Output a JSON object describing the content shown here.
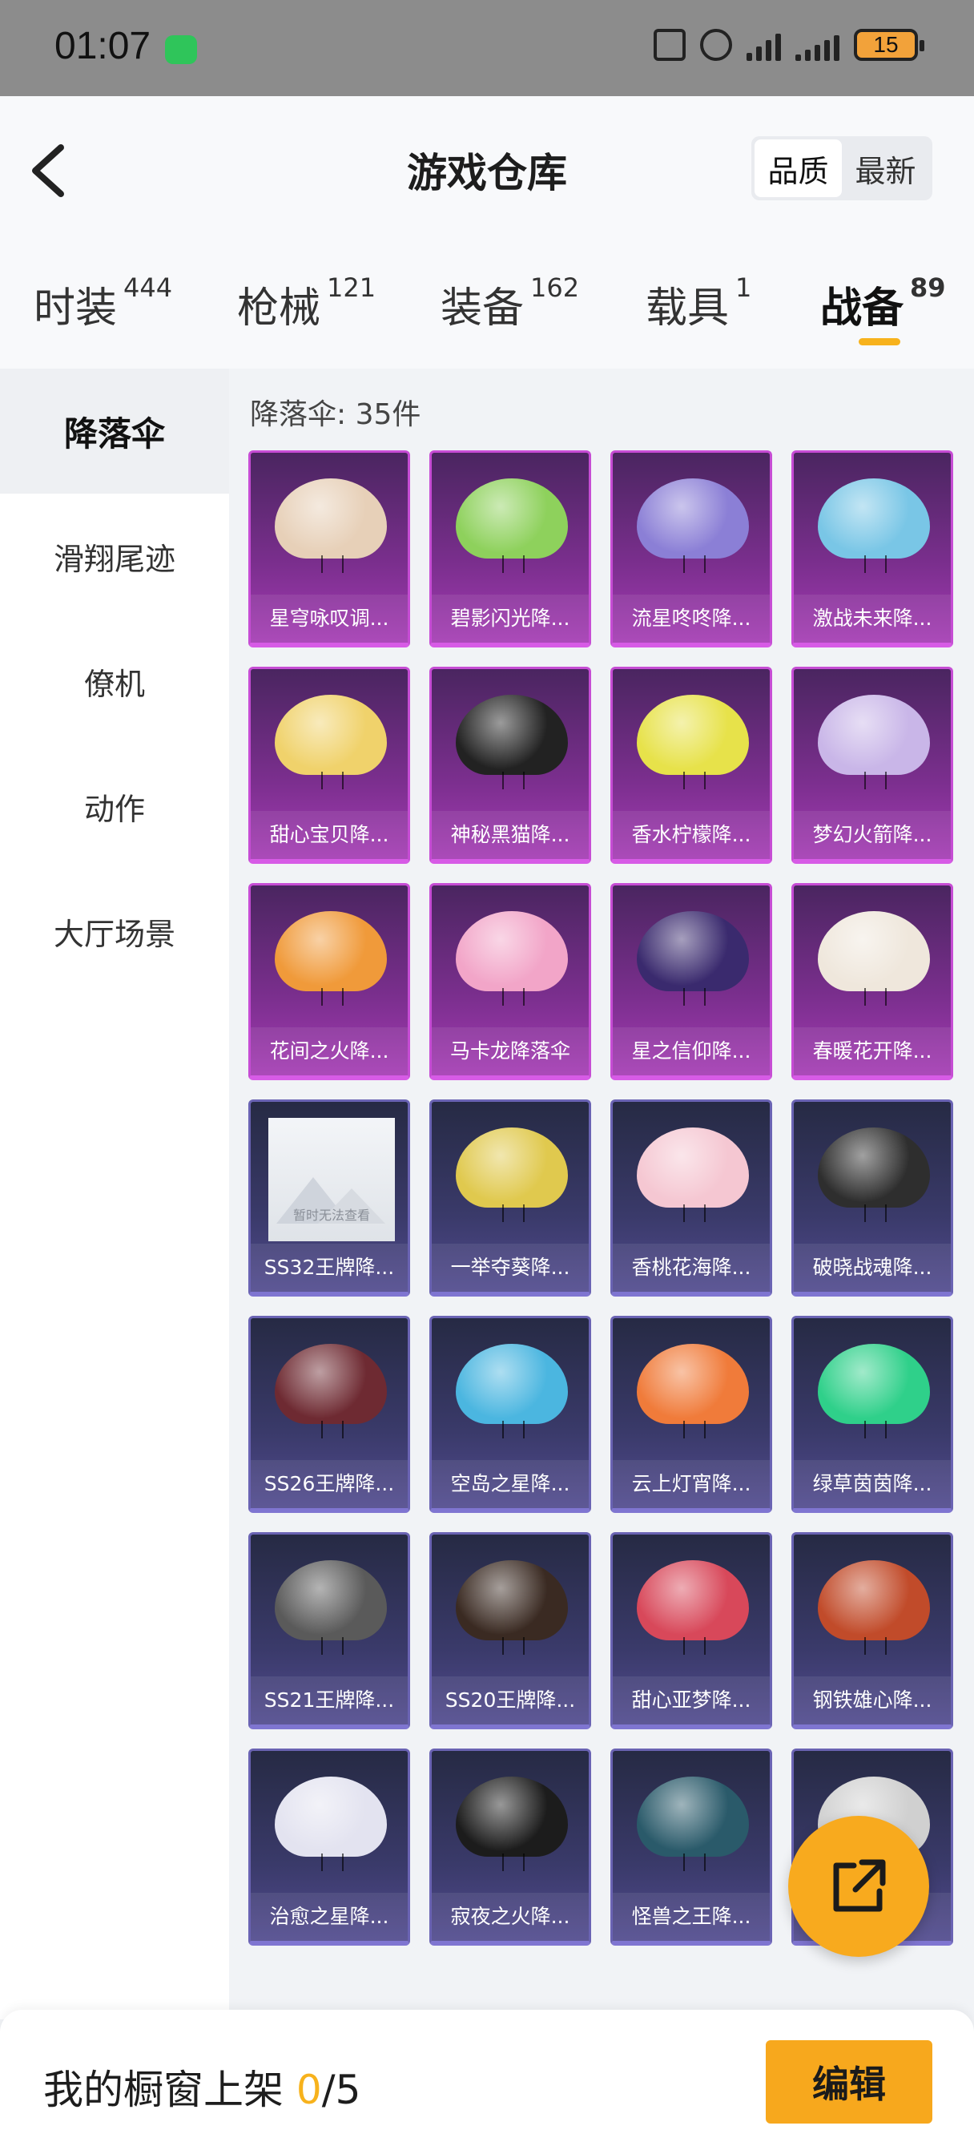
{
  "status_bar": {
    "time": "01:07",
    "battery": "15"
  },
  "header": {
    "title": "游戏仓库",
    "sort_options": [
      "品质",
      "最新"
    ]
  },
  "tabs": [
    {
      "label": "时装",
      "count": "444"
    },
    {
      "label": "枪械",
      "count": "121"
    },
    {
      "label": "装备",
      "count": "162"
    },
    {
      "label": "载具",
      "count": "1"
    },
    {
      "label": "战备",
      "count": "89"
    }
  ],
  "sidebar": [
    "降落伞",
    "滑翔尾迹",
    "僚机",
    "动作",
    "大厅场景"
  ],
  "grid_label": "降落伞: 35件",
  "items": [
    {
      "name": "星穹咏叹调...",
      "tier": "purple",
      "color": "#e7d0b8"
    },
    {
      "name": "碧影闪光降...",
      "tier": "purple",
      "color": "#8ed15c"
    },
    {
      "name": "流星咚咚降...",
      "tier": "purple",
      "color": "#8b7fd6"
    },
    {
      "name": "激战未来降...",
      "tier": "purple",
      "color": "#79c6e6"
    },
    {
      "name": "甜心宝贝降...",
      "tier": "purple",
      "color": "#f0d26b"
    },
    {
      "name": "神秘黑猫降...",
      "tier": "purple",
      "color": "#222222"
    },
    {
      "name": "香水柠檬降...",
      "tier": "purple",
      "color": "#e7e24a"
    },
    {
      "name": "梦幻火箭降...",
      "tier": "purple",
      "color": "#c9b6e8"
    },
    {
      "name": "花间之火降...",
      "tier": "purple",
      "color": "#f09a3a"
    },
    {
      "name": "马卡龙降落伞",
      "tier": "purple",
      "color": "#f2a5c8"
    },
    {
      "name": "星之信仰降...",
      "tier": "purple",
      "color": "#3a2a6e"
    },
    {
      "name": "春暖花开降...",
      "tier": "purple",
      "color": "#efe7dc"
    },
    {
      "name": "SS32王牌降...",
      "tier": "blue",
      "color": "",
      "placeholder": true,
      "placeholder_text": "暂时无法查看"
    },
    {
      "name": "一举夺葵降...",
      "tier": "blue",
      "color": "#e0c94e"
    },
    {
      "name": "香桃花海降...",
      "tier": "blue",
      "color": "#f5c7d2"
    },
    {
      "name": "破晓战魂降...",
      "tier": "blue",
      "color": "#2e2e2e"
    },
    {
      "name": "SS26王牌降...",
      "tier": "blue",
      "color": "#6e2a32"
    },
    {
      "name": "空岛之星降...",
      "tier": "blue",
      "color": "#4bb6e0"
    },
    {
      "name": "云上灯宵降...",
      "tier": "blue",
      "color": "#f07b3a"
    },
    {
      "name": "绿草茵茵降...",
      "tier": "blue",
      "color": "#2fd08a"
    },
    {
      "name": "SS21王牌降...",
      "tier": "blue",
      "color": "#5a5a5a"
    },
    {
      "name": "SS20王牌降...",
      "tier": "blue",
      "color": "#3a2a22"
    },
    {
      "name": "甜心亚梦降...",
      "tier": "blue",
      "color": "#d8485a"
    },
    {
      "name": "钢铁雄心降...",
      "tier": "blue",
      "color": "#c14b2a"
    },
    {
      "name": "治愈之星降...",
      "tier": "blue",
      "color": "#e3e3f0"
    },
    {
      "name": "寂夜之火降...",
      "tier": "blue",
      "color": "#1c1c1c"
    },
    {
      "name": "怪兽之王降...",
      "tier": "blue",
      "color": "#2a5a6a"
    },
    {
      "name": "",
      "tier": "blue",
      "color": "#d0d0d0"
    }
  ],
  "bottom_bar": {
    "label": "我的橱窗上架",
    "count": "0",
    "total": "/5",
    "edit_label": "编辑"
  }
}
